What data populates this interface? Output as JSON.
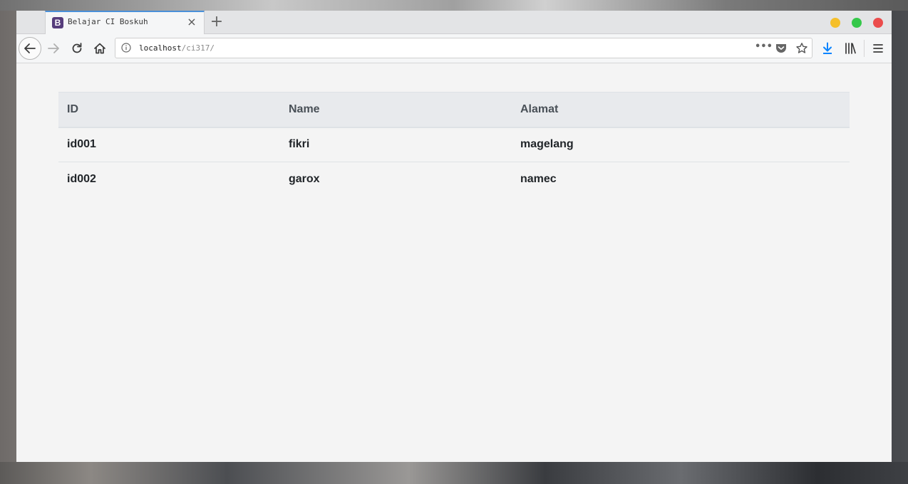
{
  "browser": {
    "tab": {
      "favicon_letter": "B",
      "title": "Belajar CI Boskuh",
      "close": "×"
    },
    "new_tab": "+",
    "url": {
      "host": "localhost",
      "path": "/ci317/"
    },
    "url_more": "•••",
    "icons": {
      "back": "back-arrow-icon",
      "forward": "forward-arrow-icon",
      "reload": "reload-icon",
      "home": "home-icon",
      "info": "info-icon",
      "pocket": "pocket-icon",
      "bookmark": "star-icon",
      "download": "download-icon",
      "library": "library-icon",
      "menu": "hamburger-menu-icon"
    },
    "colors": {
      "tab_accent": "#4a90d9",
      "minimize": "#f5bf2a",
      "maximize": "#35c84a",
      "close": "#eb4c4c",
      "download_icon": "#0a84ff",
      "favicon_bg": "#563d7c"
    }
  },
  "table": {
    "headers": [
      "ID",
      "Name",
      "Alamat"
    ],
    "rows": [
      [
        "id001",
        "fikri",
        "magelang"
      ],
      [
        "id002",
        "garox",
        "namec"
      ]
    ]
  }
}
